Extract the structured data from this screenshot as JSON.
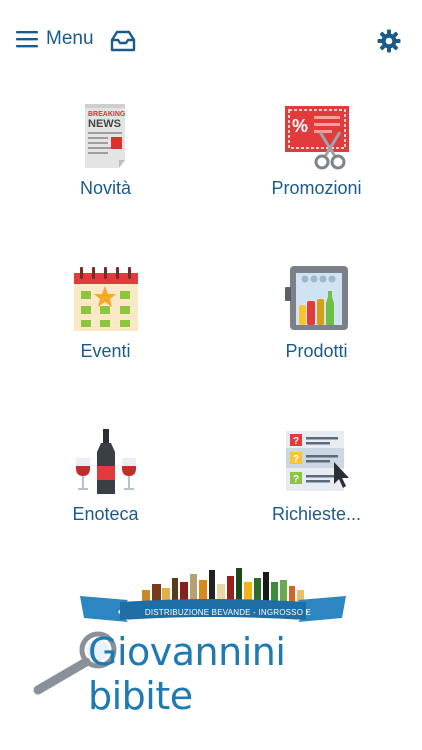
{
  "header": {
    "menu_label": "Menu",
    "menu_icon": "hamburger-icon",
    "inbox_icon": "inbox-icon",
    "settings_icon": "gear-icon"
  },
  "tiles": [
    {
      "label": "Novità",
      "icon": "newspaper-icon"
    },
    {
      "label": "Promozioni",
      "icon": "coupon-icon"
    },
    {
      "label": "Eventi",
      "icon": "calendar-icon"
    },
    {
      "label": "Prodotti",
      "icon": "fridge-icon"
    },
    {
      "label": "Enoteca",
      "icon": "wine-icon"
    },
    {
      "label": "Richieste...",
      "icon": "requests-icon"
    }
  ],
  "news_icon_text": [
    "BREAKING",
    "NEWS"
  ],
  "logo": {
    "title": "Giovannini bibite",
    "banner": "DISTRIBUZIONE BEVANDE - INGROSSO E DETTAGLIO"
  },
  "colors": {
    "brand_blue": "#1a5b8c",
    "logo_blue": "#1f79b3",
    "accent_red": "#d9342b"
  }
}
